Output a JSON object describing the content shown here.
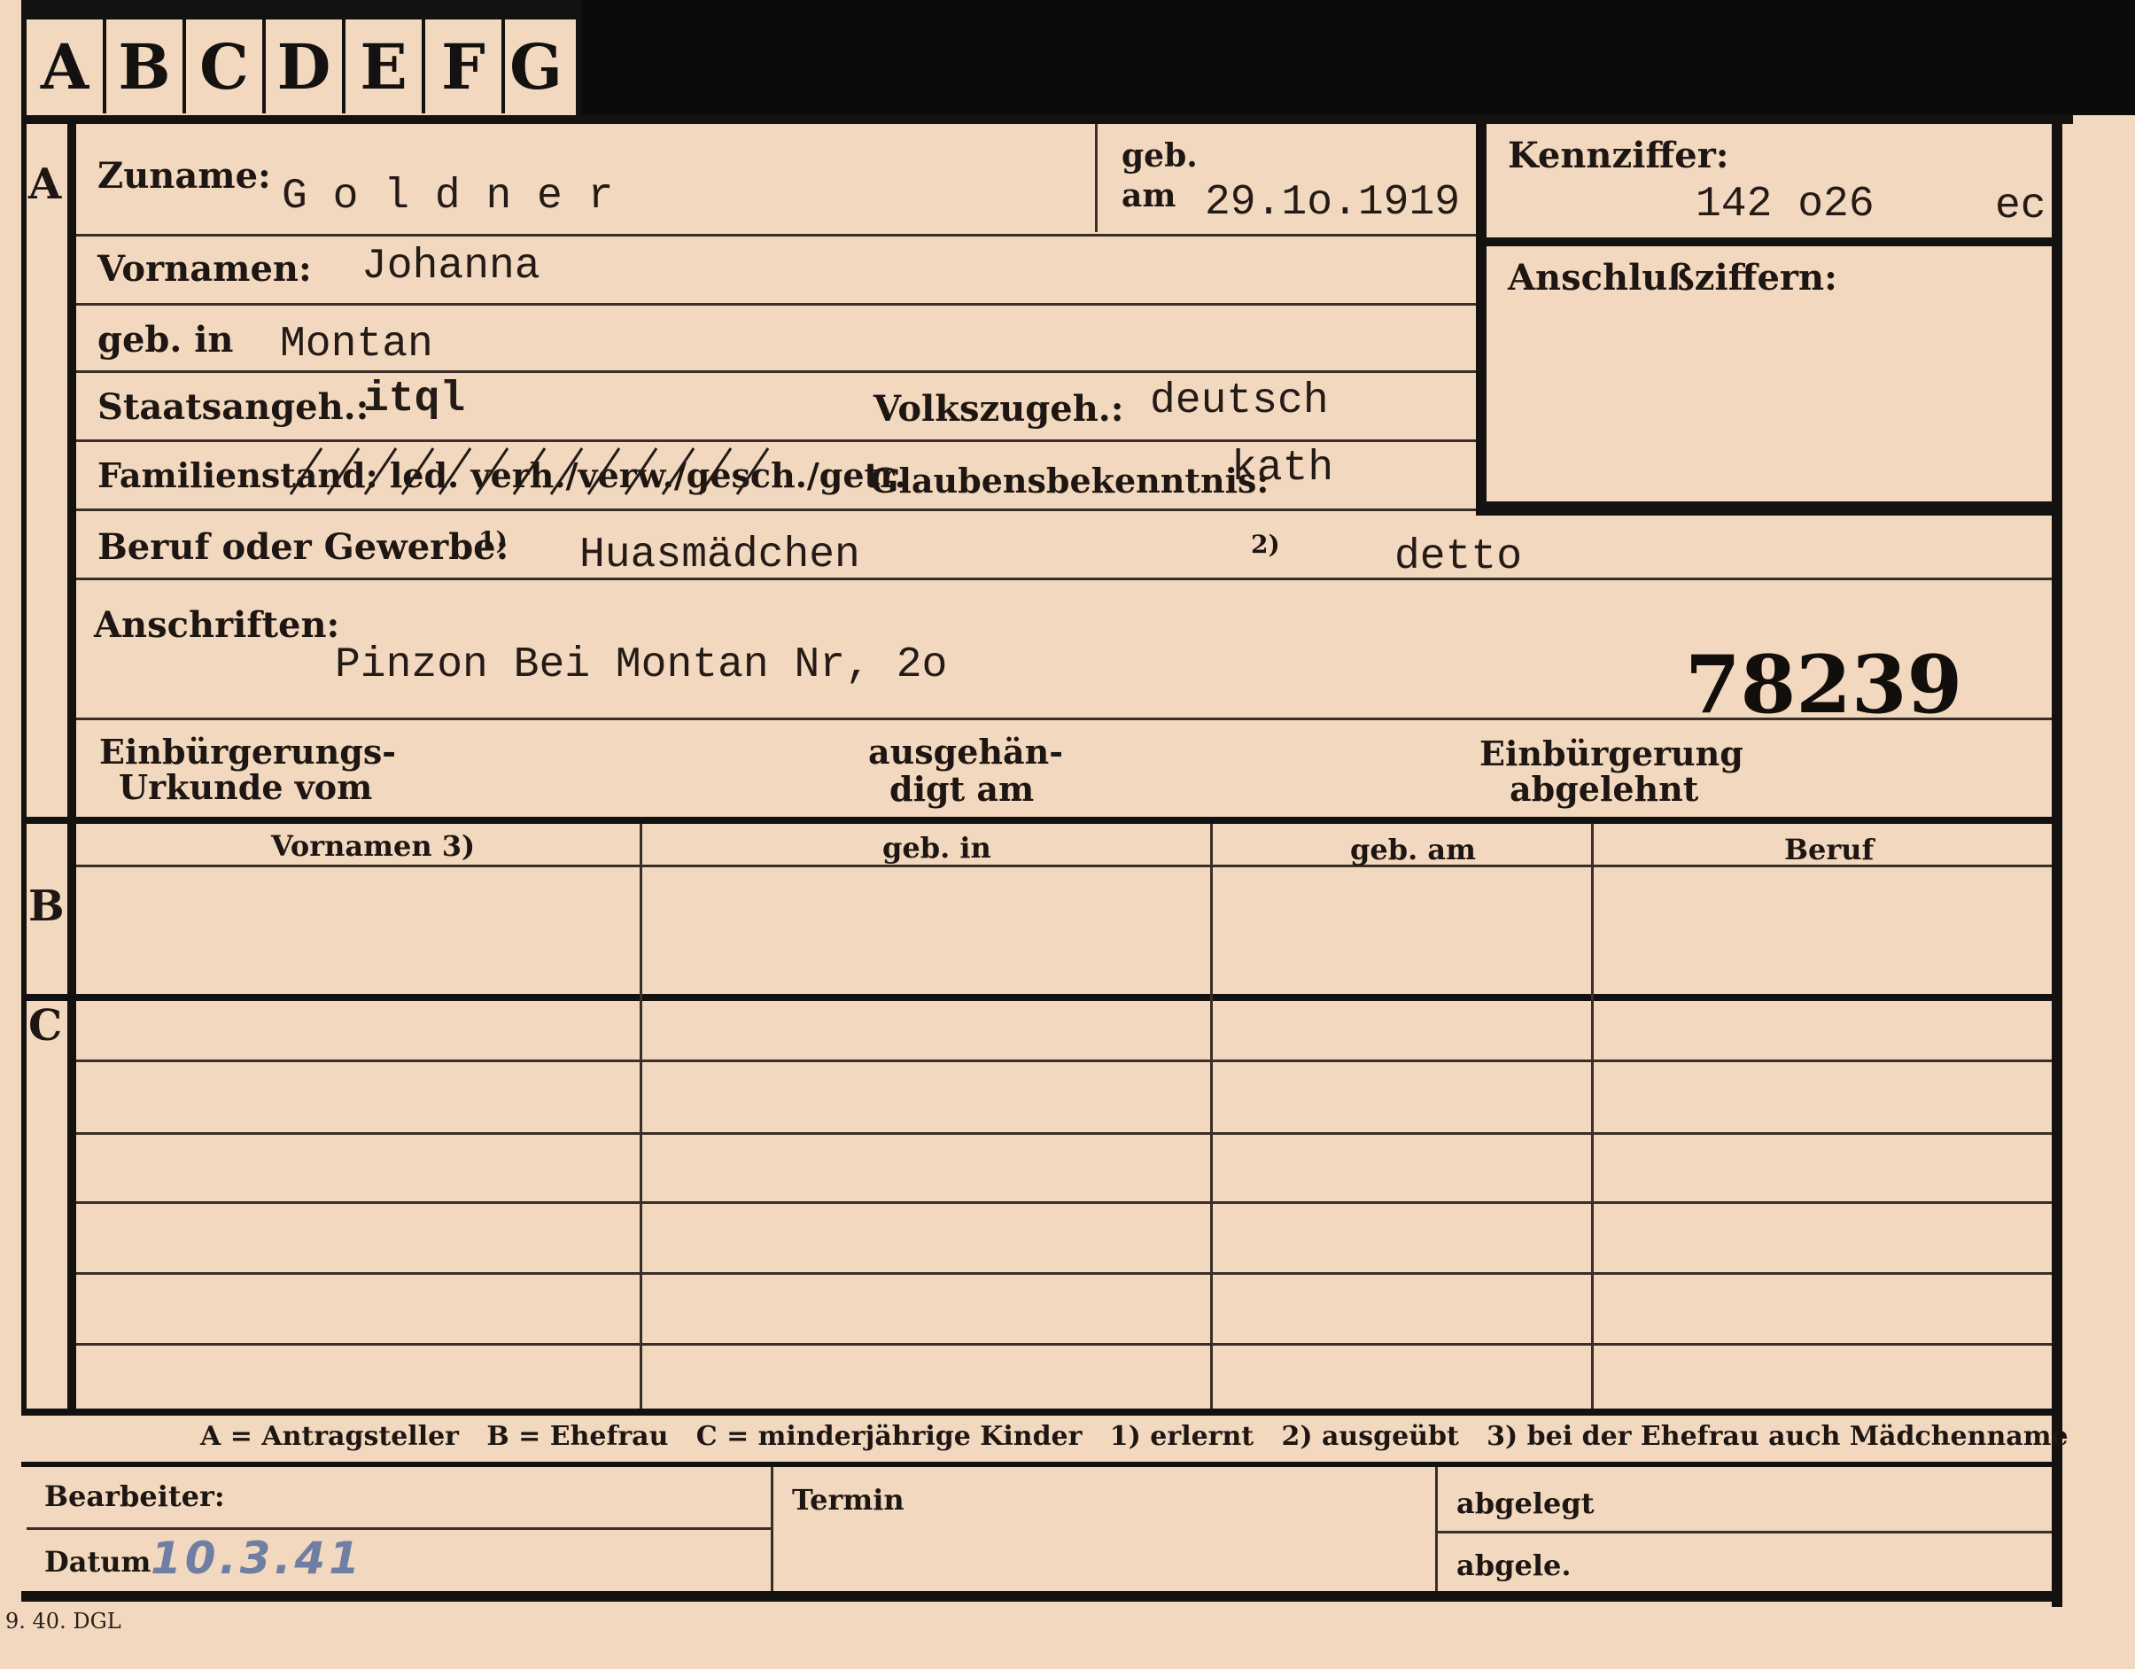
{
  "tabs": [
    "A",
    "B",
    "C",
    "D",
    "E",
    "F",
    "G"
  ],
  "sections": {
    "a": "A",
    "b": "B",
    "c": "C"
  },
  "labels": {
    "surname": "Zuname:",
    "birth_geb": "geb.",
    "birth_am": "am",
    "reference": "Kennziffer:",
    "given_names": "Vornamen:",
    "connection_numbers": "Anschlußziffern:",
    "birthplace": "geb. in",
    "citizenship": "Staatsangeh.:",
    "ethnicity": "Volkszugeh.:",
    "marital_status": "Familienstand: led. verh./verw./gesch./getr.",
    "religion": "Glaubensbekenntnis:",
    "occupation": "Beruf oder Gewerbe:",
    "occ_mark1": "1)",
    "occ_mark2": "2)",
    "addresses": "Anschriften:",
    "naturalisation_cert_1": "Einbürgerungs-",
    "naturalisation_cert_2": "Urkunde vom",
    "handed_1": "ausgehän-",
    "handed_2": "digt am",
    "naturalisation_denied_1": "Einbürgerung",
    "naturalisation_denied_2": "abgelehnt"
  },
  "values": {
    "surname": "G o l d n e r",
    "birth_date": "29.1o.1919",
    "reference_number": "142 o26",
    "reference_suffix": "ec",
    "given_names": "Johanna",
    "birthplace": "Montan",
    "citizenship": "itql",
    "ethnicity": "deutsch",
    "religion": "kath",
    "occupation_learned": "Huasmädchen",
    "occupation_practised": "detto",
    "address": "Pinzon Bei Montan Nr,  2o",
    "stamp_number": "78239"
  },
  "family_table": {
    "headers": [
      "Vornamen 3)",
      "geb. in",
      "geb. am",
      "Beruf"
    ]
  },
  "legend": "A = Antragsteller   B = Ehefrau   C = minderjährige Kinder   1) erlernt   2) ausgeübt   3) bei der Ehefrau auch Mädchenname",
  "footer": {
    "clerk": "Bearbeiter:",
    "date_label": "Datum",
    "date_value": "10.3.41",
    "deadline": "Termin",
    "filed": "abgelegt",
    "filed_abbrev": "abgele.",
    "print_code": "9. 40. DGL"
  }
}
